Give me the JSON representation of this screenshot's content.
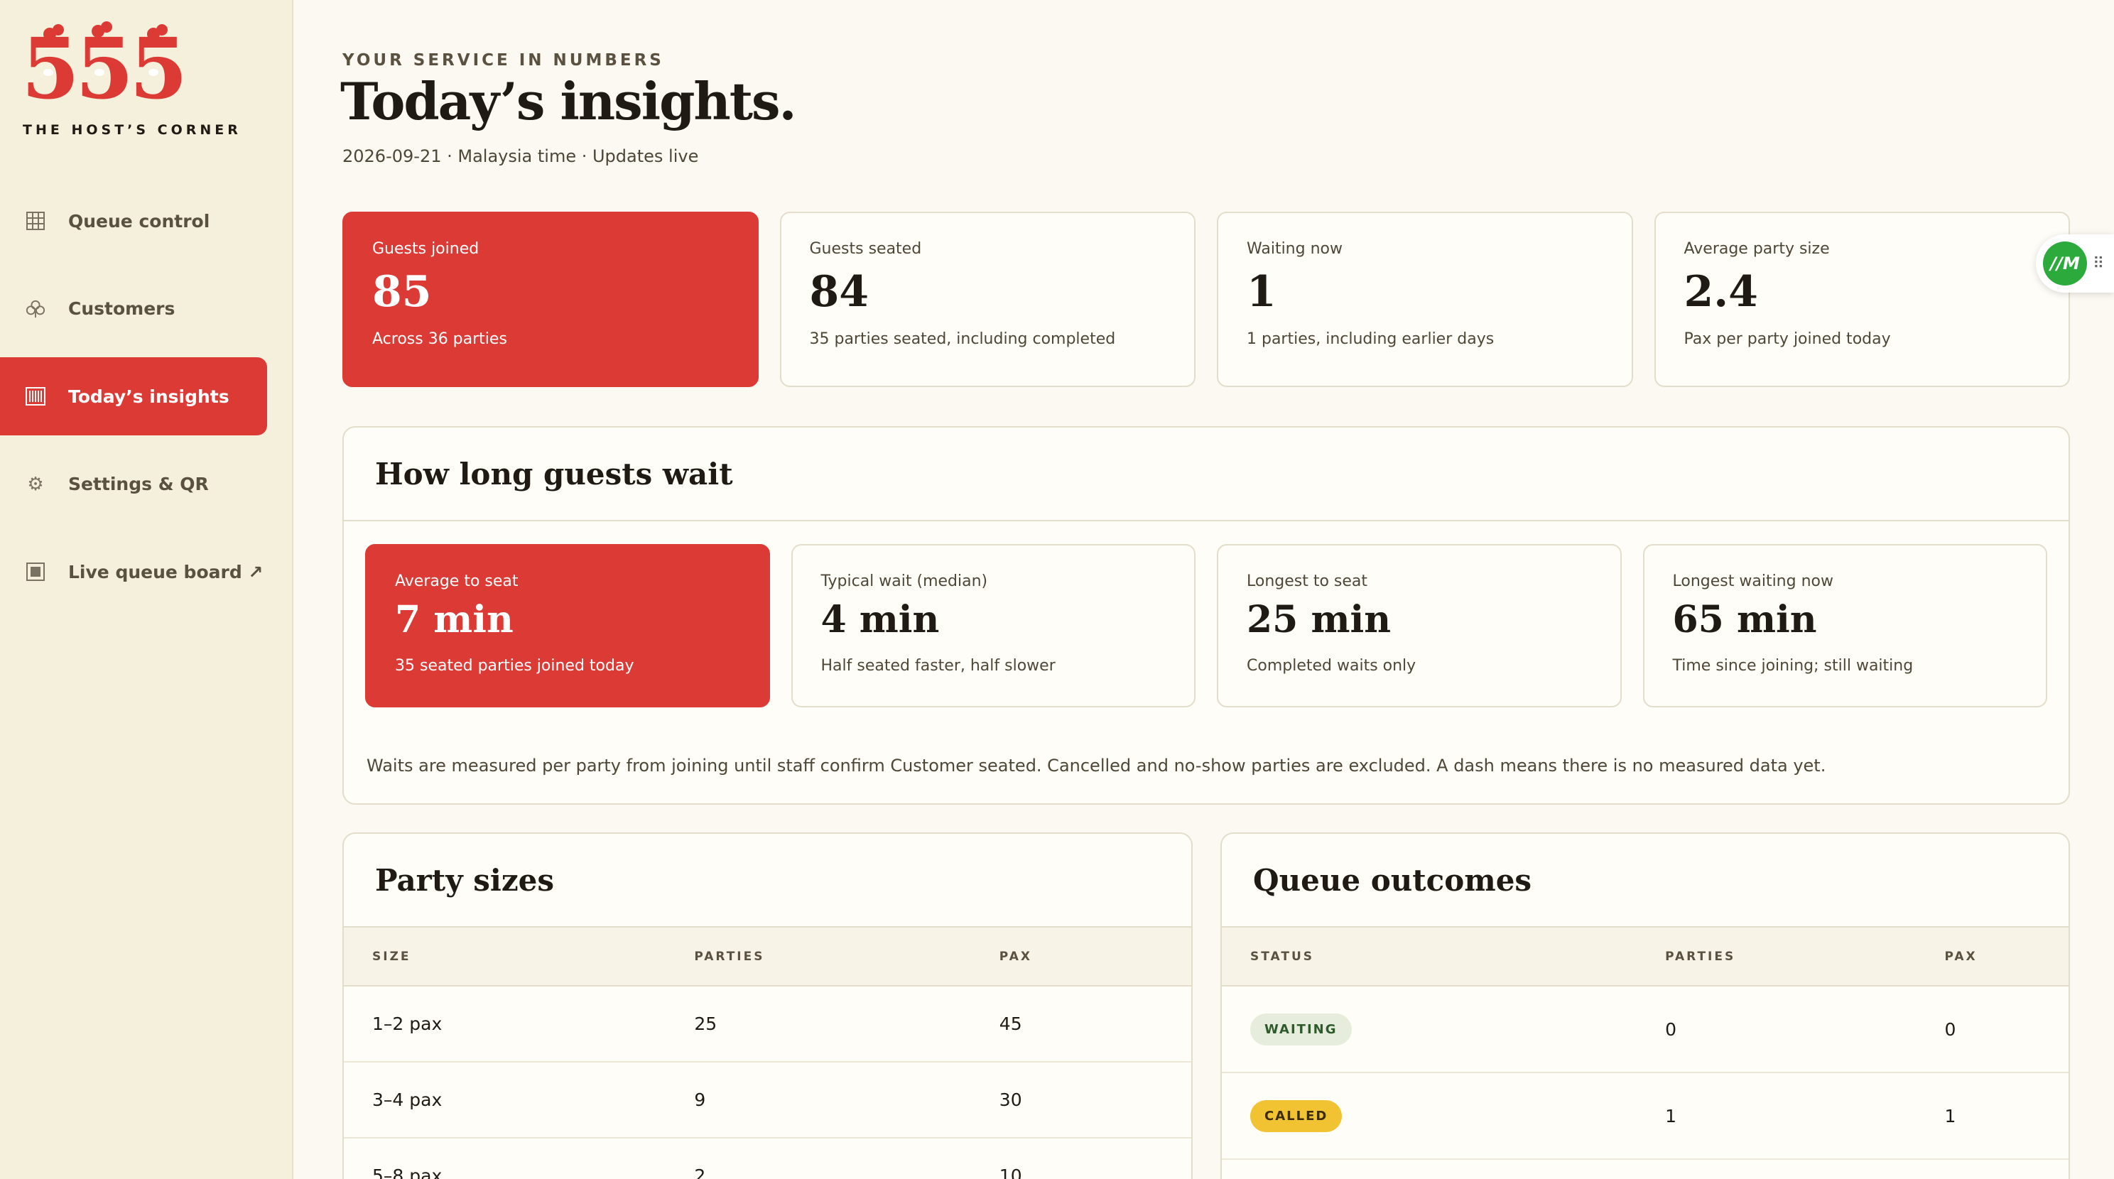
{
  "brand": {
    "logo_text": "555",
    "caption": "THE HOST’S CORNER",
    "color": "#dc3a35"
  },
  "nav": {
    "items": [
      {
        "label": "Queue control",
        "icon": "grid-icon"
      },
      {
        "label": "Customers",
        "icon": "club-icon"
      },
      {
        "label": "Today’s insights",
        "icon": "barcode-icon",
        "active": true
      },
      {
        "label": "Settings & QR",
        "icon": "gear-icon"
      },
      {
        "label": "Live queue board ↗",
        "icon": "board-icon"
      }
    ]
  },
  "header": {
    "eyebrow": "YOUR SERVICE IN NUMBERS",
    "title": "Today’s insights.",
    "subtitle": "2026-09-21 · Malaysia time · Updates live"
  },
  "stats": [
    {
      "label": "Guests joined",
      "value": "85",
      "note": "Across 36 parties"
    },
    {
      "label": "Guests seated",
      "value": "84",
      "note": "35 parties seated, including completed"
    },
    {
      "label": "Waiting now",
      "value": "1",
      "note": "1 parties, including earlier days"
    },
    {
      "label": "Average party size",
      "value": "2.4",
      "note": "Pax per party joined today"
    }
  ],
  "wait": {
    "title": "How long guests wait",
    "cards": [
      {
        "label": "Average to seat",
        "value": "7 min",
        "note": "35 seated parties joined today"
      },
      {
        "label": "Typical wait (median)",
        "value": "4 min",
        "note": "Half seated faster, half slower"
      },
      {
        "label": "Longest to seat",
        "value": "25 min",
        "note": "Completed waits only"
      },
      {
        "label": "Longest waiting now",
        "value": "65 min",
        "note": "Time since joining; still waiting"
      }
    ],
    "footnote": "Waits are measured per party from joining until staff confirm Customer seated. Cancelled and no-show parties are excluded. A dash means there is no measured data yet."
  },
  "party_sizes": {
    "title": "Party sizes",
    "headers": [
      "SIZE",
      "PARTIES",
      "PAX"
    ],
    "rows": [
      [
        "1–2 pax",
        "25",
        "45"
      ],
      [
        "3–4 pax",
        "9",
        "30"
      ],
      [
        "5–8 pax",
        "2",
        "10"
      ]
    ]
  },
  "outcomes": {
    "title": "Queue outcomes",
    "headers": [
      "STATUS",
      "PARTIES",
      "PAX"
    ],
    "rows": [
      {
        "status": "WAITING",
        "parties": "0",
        "pax": "0"
      },
      {
        "status": "CALLED",
        "parties": "1",
        "pax": "1"
      }
    ]
  },
  "widget": {
    "badge": "//M",
    "icon": "drag-grip-icon"
  }
}
